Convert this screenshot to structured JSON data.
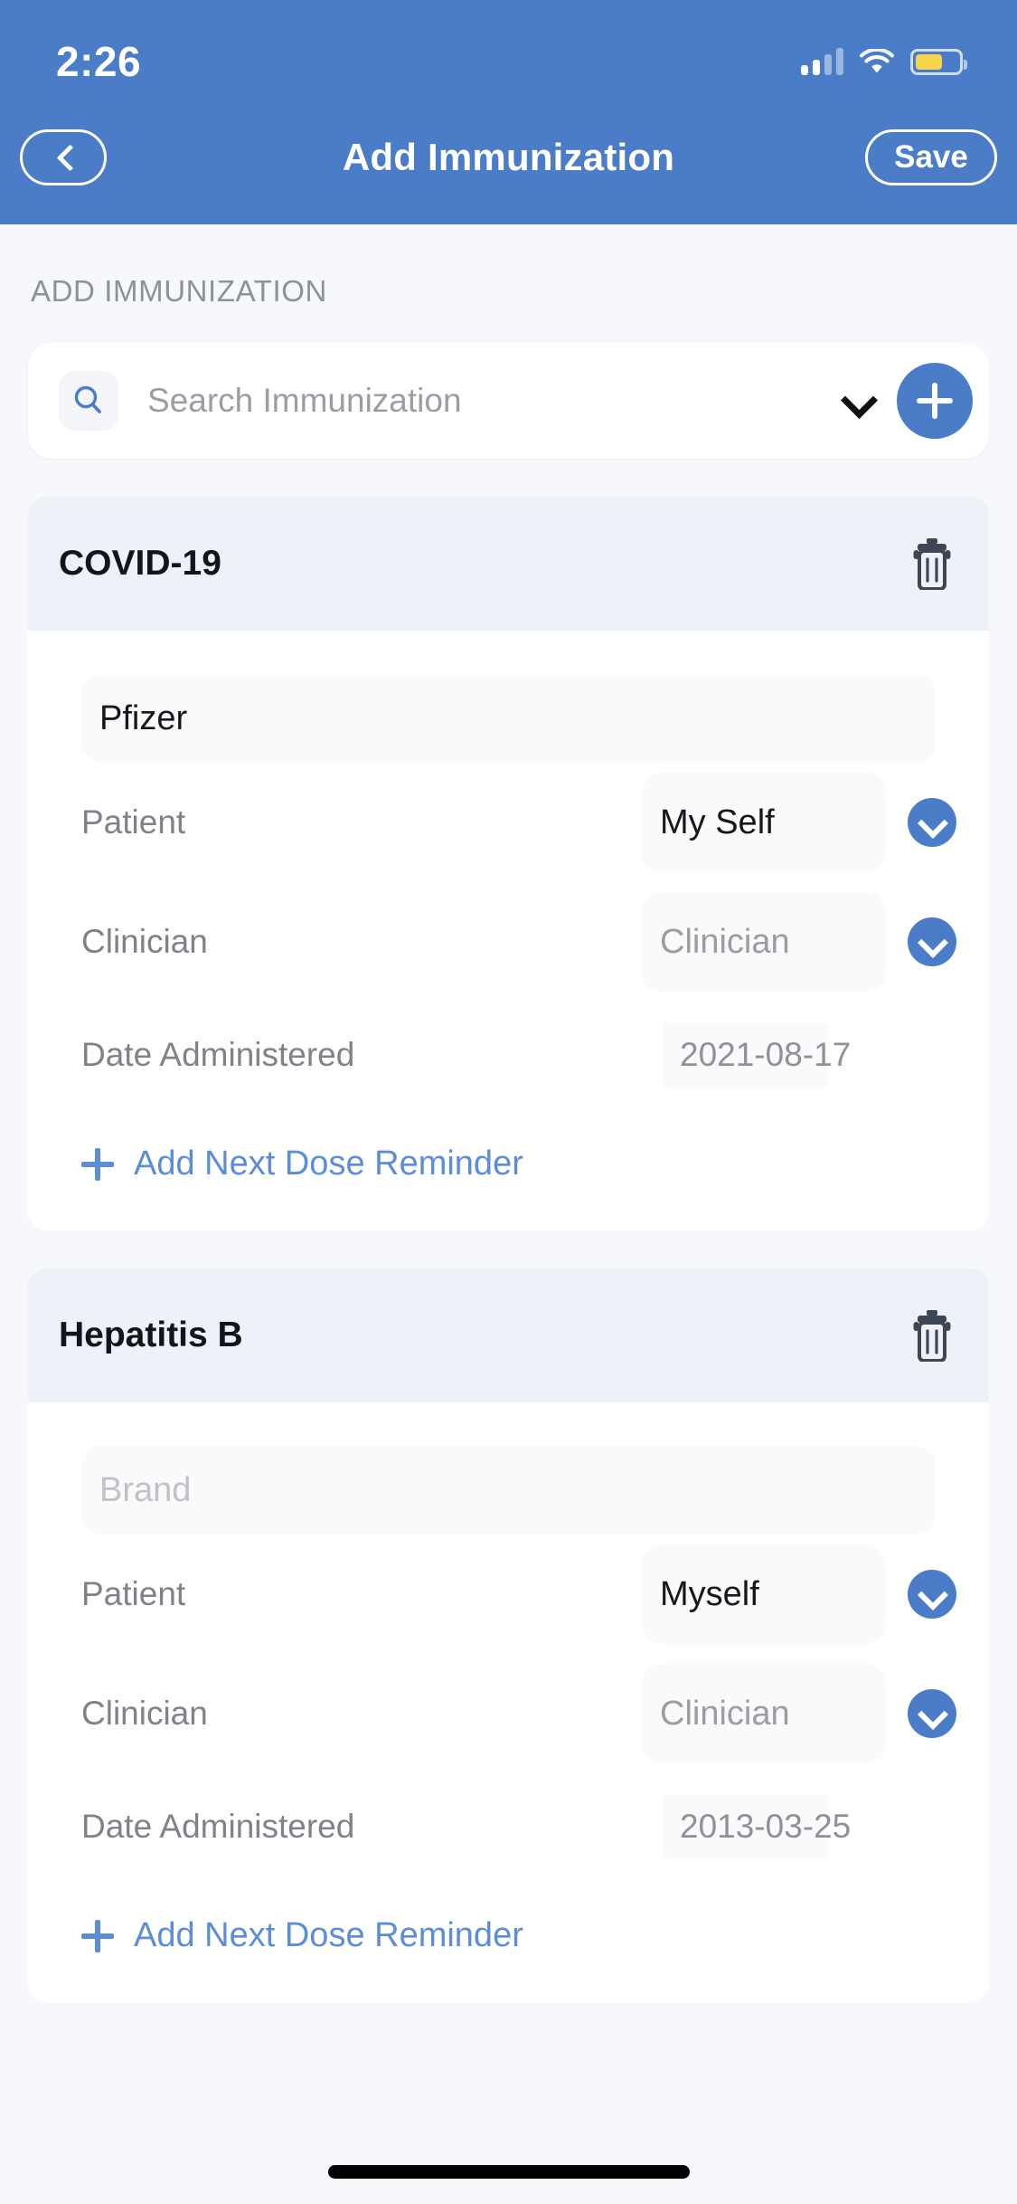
{
  "status_bar": {
    "time": "2:26",
    "signal_icon": "cellular-signal-icon",
    "wifi_icon": "wifi-icon",
    "battery_icon": "battery-icon",
    "battery_level_percent": 62
  },
  "navbar": {
    "back_icon": "chevron-left-icon",
    "title": "Add Immunization",
    "save_label": "Save"
  },
  "colors": {
    "header_blue": "#4a7cc7",
    "accent_blue": "#4a7cc7",
    "link_blue": "#5b8dd9",
    "page_bg": "#f6f8fc",
    "card_header_bg": "#eef1f7",
    "field_bg": "#fafafb",
    "battery_yellow": "#f5d34b"
  },
  "main": {
    "section_label": "ADD IMMUNIZATION",
    "search": {
      "search_icon": "search-icon",
      "placeholder": "Search Immunization",
      "chevron_icon": "chevron-down-icon",
      "add_icon": "plus-icon"
    },
    "cards": [
      {
        "title": "COVID-19",
        "delete_icon": "trash-icon",
        "brand": {
          "value": "Pfizer",
          "placeholder": "Brand",
          "filled": true
        },
        "fields": [
          {
            "label": "Patient",
            "value": "My Self",
            "placeholder": "Patient",
            "filled": true,
            "chevron_icon": "chevron-down-icon"
          },
          {
            "label": "Clinician",
            "value": "Clinician",
            "placeholder": "Clinician",
            "filled": false,
            "chevron_icon": "chevron-down-icon"
          }
        ],
        "date": {
          "label": "Date Administered",
          "value": "2021-08-17"
        },
        "add_reminder": {
          "icon": "plus-icon",
          "label": "Add Next Dose Reminder"
        }
      },
      {
        "title": "Hepatitis B",
        "delete_icon": "trash-icon",
        "brand": {
          "value": "",
          "placeholder": "Brand",
          "filled": false
        },
        "fields": [
          {
            "label": "Patient",
            "value": "Myself",
            "placeholder": "Patient",
            "filled": true,
            "chevron_icon": "chevron-down-icon"
          },
          {
            "label": "Clinician",
            "value": "Clinician",
            "placeholder": "Clinician",
            "filled": false,
            "chevron_icon": "chevron-down-icon"
          }
        ],
        "date": {
          "label": "Date Administered",
          "value": "2013-03-25"
        },
        "add_reminder": {
          "icon": "plus-icon",
          "label": "Add Next Dose Reminder"
        }
      }
    ]
  },
  "home_indicator": "home-indicator-bar"
}
